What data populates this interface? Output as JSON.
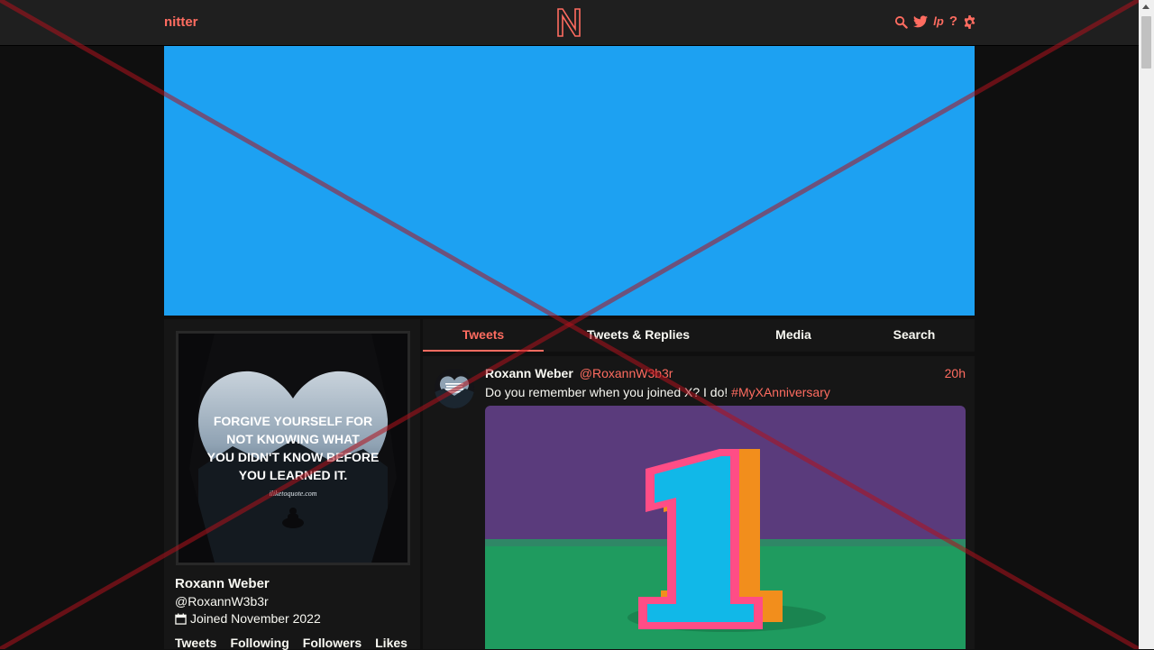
{
  "navbar": {
    "brand": "nitter",
    "logo_letter": "N",
    "icons": [
      "search-icon",
      "twitter-bird-icon",
      "liberapay-icon",
      "help-icon",
      "settings-gear-icon"
    ],
    "help_glyph": "?",
    "liberapay_glyph": "lp"
  },
  "profile": {
    "name": "Roxann Weber",
    "handle": "@RoxannW3b3r",
    "joined": "Joined November 2022",
    "avatar_quote": [
      "FORGIVE YOURSELF FOR",
      "NOT KNOWING WHAT",
      "YOU DIDN'T KNOW BEFORE",
      "YOU LEARNED IT."
    ],
    "avatar_site": "iliketoquote.com",
    "stats": [
      "Tweets",
      "Following",
      "Followers",
      "Likes"
    ]
  },
  "tabs": [
    {
      "label": "Tweets",
      "active": true
    },
    {
      "label": "Tweets & Replies",
      "active": false
    },
    {
      "label": "Media",
      "active": false
    },
    {
      "label": "Search",
      "active": false
    }
  ],
  "tweet": {
    "name": "Roxann Weber",
    "handle": "@RoxannW3b3r",
    "time": "20h",
    "text": "Do you remember when you joined X? I do! ",
    "hashtag": "#MyXAnniversary",
    "media_digit": "1"
  },
  "colors": {
    "accent": "#ff6c60",
    "banner": "#1da1f2",
    "background": "#0f0f0f",
    "panel": "#161616",
    "navbar": "#1f1f1f"
  }
}
